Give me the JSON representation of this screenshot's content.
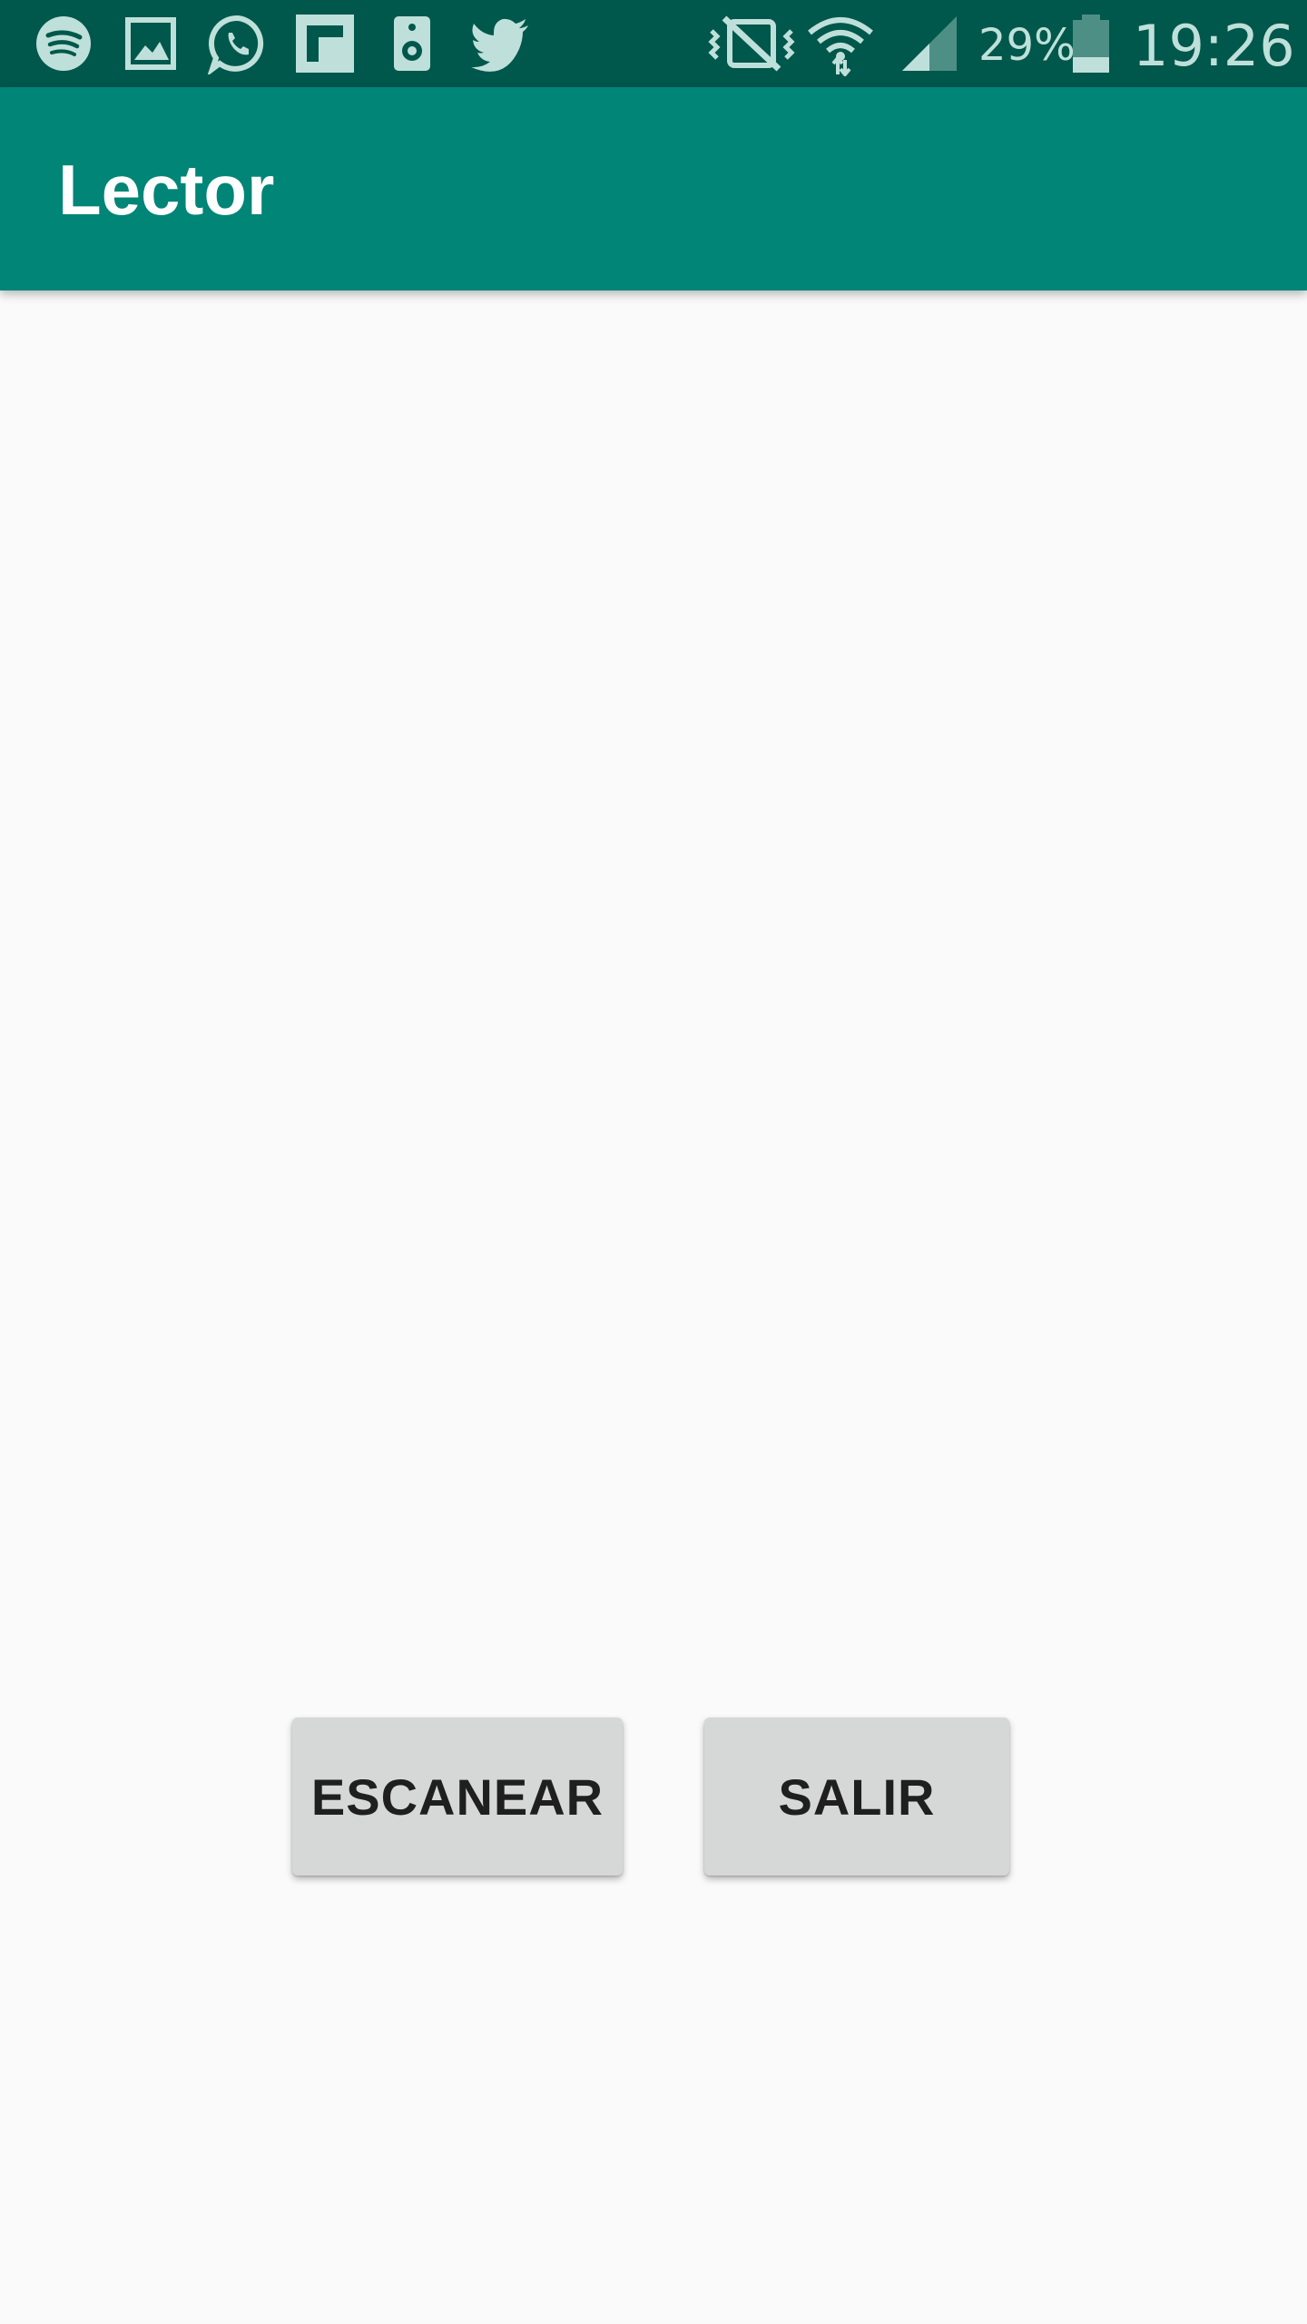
{
  "status_bar": {
    "left_icons": [
      "spotify-icon",
      "gallery-icon",
      "whatsapp-icon",
      "flipboard-icon",
      "speaker-icon",
      "twitter-icon"
    ],
    "right_icons": [
      "vibrate-mute-icon",
      "wifi-icon",
      "signal-icon",
      "battery-icon"
    ],
    "battery_percent": "29%",
    "time": "19:26",
    "battery_level": 0.29
  },
  "app_bar": {
    "title": "Lector"
  },
  "main": {
    "scan_button_label": "ESCANEAR",
    "exit_button_label": "SALIR"
  },
  "colors": {
    "status_bar": "#00574b",
    "app_bar": "#008577",
    "background": "#fafafa",
    "button": "#d6d7d7",
    "icon_tint": "#bfe0da"
  }
}
